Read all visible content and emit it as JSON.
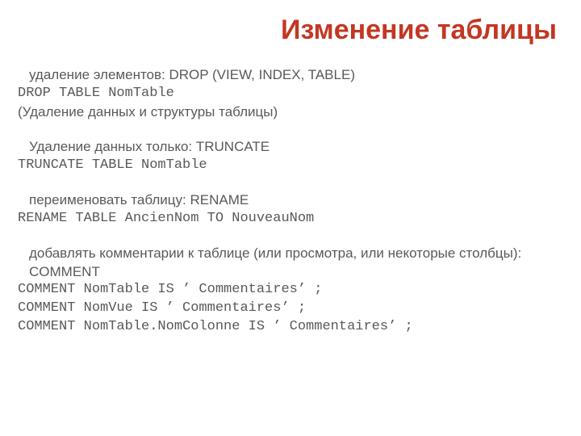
{
  "title": "Изменение таблицы",
  "sections": [
    {
      "bullet": "удаление элементов: DROP (VIEW, INDEX, TABLE)",
      "code1": "DROP TABLE NomTable",
      "note": "(Удаление данных и структуры таблицы)"
    },
    {
      "bullet": "Удаление данных только: TRUNCATE",
      "code1": "TRUNCATE TABLE NomTable"
    },
    {
      "bullet": "переименовать таблицу: RENAME",
      "code1": "RENAME TABLE AncienNom TO NouveauNom"
    },
    {
      "bullet": "добавлять комментарии к таблице (или просмотра, или некоторые столбцы): COMMENT",
      "code1": "COMMENT NomTable IS ’ Commentaires’ ;",
      "code2": "COMMENT NomVue IS ’ Commentaires’ ;",
      "code3": "COMMENT NomTable.NomColonne IS ’ Commentaires’ ;"
    }
  ]
}
